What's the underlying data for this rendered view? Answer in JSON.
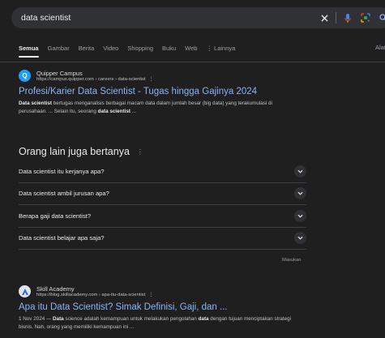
{
  "search": {
    "query": "data scientist"
  },
  "search_icons": {
    "clear": "close-icon",
    "mic": "mic-icon",
    "lens": "lens-icon",
    "search": "search-icon"
  },
  "tabs": {
    "items": [
      "Semua",
      "Gambar",
      "Berita",
      "Video",
      "Shopping",
      "Buku",
      "Web",
      "⋮ Lainnya"
    ],
    "active": "Semua",
    "tools": "Alat"
  },
  "result1": {
    "site_name": "Quipper Campus",
    "url": "https://campus.quipper.com › careers › data-scientist",
    "title": "Profesi/Karier Data Scientist - Tugas hingga Gajinya 2024",
    "snippet_parts": [
      {
        "b": "Data scientist"
      },
      {
        "t": " bertugas menganalisis berbagai macam data dalam jumlah besar (big data) yang terakumulasi di perusahaan. ... Selain itu, seorang "
      },
      {
        "b": "data scientist"
      },
      {
        "t": " ..."
      }
    ],
    "favicon_color": "#1a9fff"
  },
  "paa": {
    "title": "Orang lain juga bertanya",
    "questions": [
      "Data scientist itu kerjanya apa?",
      "Data scientist ambil jurusan apa?",
      "Berapa gaji data scientist?",
      "Data scientist belajar apa saja?"
    ],
    "feedback": "Masukan"
  },
  "result2": {
    "site_name": "Skill Academy",
    "url": "https://blog.skillacademy.com › apa-itu-data-scientist",
    "title": "Apa itu Data Scientist? Simak Definisi, Gaji, dan ...",
    "snippet_parts": [
      {
        "t": "1 Nov 2024 — "
      },
      {
        "b": "Data"
      },
      {
        "t": " science adalah kemampuan untuk melakukan pengolahan "
      },
      {
        "b": "data"
      },
      {
        "t": " dengan tujuan menciptakan strategi bisnis. Nah, orang yang memiliki kemampuan ini ..."
      }
    ],
    "favicon_color": "#2b6fd6"
  },
  "colors": {
    "background": "#1f1f1f",
    "link": "#8ab4f8",
    "text": "#e8eaed",
    "muted": "#9aa0a6"
  }
}
